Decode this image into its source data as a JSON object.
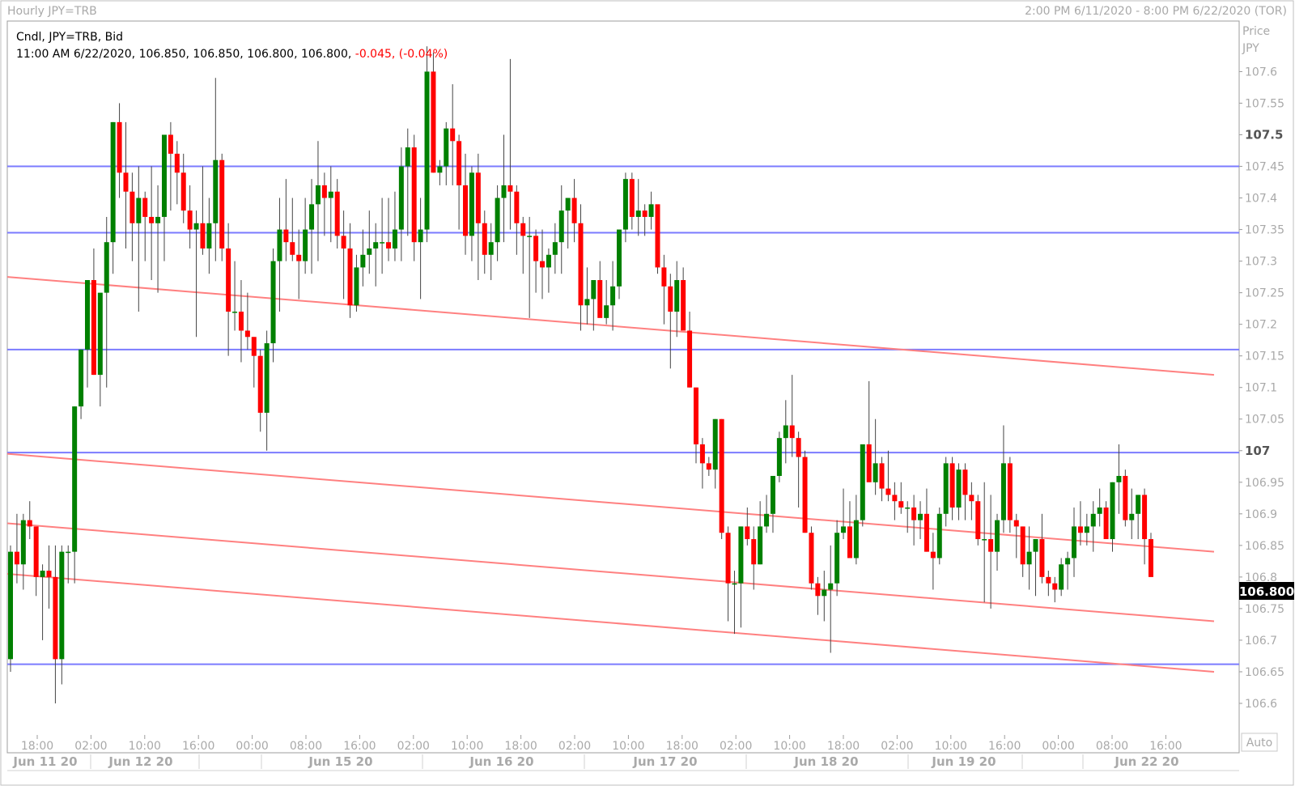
{
  "header": {
    "title": "Hourly JPY=TRB",
    "range": "2:00 PM 6/11/2020 - 8:00 PM 6/22/2020 (TOR)"
  },
  "legend": {
    "line1": "Cndl, JPY=TRB, Bid",
    "line2_prefix": "11:00 AM 6/22/2020, 106.850, 106.850, 106.800, 106.800, ",
    "line2_change": "-0.045, (-0.04%)"
  },
  "axis": {
    "price_label": "Price",
    "currency_label": "JPY",
    "current_price": "106.800",
    "auto_label": "Auto"
  },
  "colors": {
    "up": "#008000",
    "down": "#ff0000",
    "horizontal_levels": "#7b7bff",
    "trend_lines": "#ff8080",
    "price_tag_bg": "#000000"
  },
  "chart_data": {
    "type": "candlestick",
    "ylim": [
      106.55,
      107.68
    ],
    "y_ticks": [
      "106.6",
      "106.65",
      "106.7",
      "106.75",
      "106.8",
      "106.85",
      "106.9",
      "106.95",
      "107",
      "107.05",
      "107.1",
      "107.15",
      "107.2",
      "107.25",
      "107.3",
      "107.35",
      "107.4",
      "107.45",
      "107.5",
      "107.55",
      "107.6"
    ],
    "y_major_ticks": [
      "107",
      "107.5"
    ],
    "x_ticks": [
      "18:00",
      "02:00",
      "10:00",
      "16:00",
      "00:00",
      "08:00",
      "16:00",
      "02:00",
      "10:00",
      "18:00",
      "02:00",
      "10:00",
      "18:00",
      "02:00",
      "10:00",
      "18:00",
      "02:00",
      "10:00",
      "16:00",
      "00:00",
      "08:00",
      "16:00"
    ],
    "date_labels": [
      "Jun 11 20",
      "Jun 12 20",
      "Jun 15 20",
      "Jun 16 20",
      "Jun 17 20",
      "Jun 18 20",
      "Jun 19 20",
      "Jun 22 20"
    ],
    "horizontal_levels": [
      107.45,
      107.345,
      107.16,
      106.997,
      106.662
    ],
    "trend_lines": [
      {
        "start": 107.275,
        "end": 107.12
      },
      {
        "start": 106.995,
        "end": 106.84
      },
      {
        "start": 106.885,
        "end": 106.73
      },
      {
        "start": 106.805,
        "end": 106.65
      }
    ],
    "ohlc": [
      [
        106.67,
        106.85,
        106.65,
        106.84
      ],
      [
        106.84,
        106.9,
        106.79,
        106.82
      ],
      [
        106.82,
        106.9,
        106.78,
        106.89
      ],
      [
        106.89,
        106.92,
        106.86,
        106.88
      ],
      [
        106.88,
        106.87,
        106.77,
        106.8
      ],
      [
        106.8,
        106.82,
        106.7,
        106.81
      ],
      [
        106.81,
        106.85,
        106.75,
        106.8
      ],
      [
        106.8,
        106.85,
        106.6,
        106.67
      ],
      [
        106.67,
        106.85,
        106.63,
        106.84
      ],
      [
        106.84,
        106.85,
        106.79,
        106.84
      ],
      [
        106.84,
        107.07,
        106.79,
        107.07
      ],
      [
        107.07,
        107.16,
        107.05,
        107.16
      ],
      [
        107.16,
        107.27,
        107.1,
        107.27
      ],
      [
        107.27,
        107.32,
        107.12,
        107.12
      ],
      [
        107.12,
        107.2,
        107.07,
        107.25
      ],
      [
        107.25,
        107.37,
        107.1,
        107.33
      ],
      [
        107.33,
        107.52,
        107.28,
        107.52
      ],
      [
        107.52,
        107.55,
        107.4,
        107.44
      ],
      [
        107.44,
        107.52,
        107.32,
        107.41
      ],
      [
        107.41,
        107.44,
        107.3,
        107.36
      ],
      [
        107.36,
        107.45,
        107.22,
        107.4
      ],
      [
        107.4,
        107.41,
        107.3,
        107.37
      ],
      [
        107.37,
        107.45,
        107.27,
        107.36
      ],
      [
        107.36,
        107.42,
        107.25,
        107.37
      ],
      [
        107.37,
        107.5,
        107.3,
        107.5
      ],
      [
        107.5,
        107.52,
        107.38,
        107.47
      ],
      [
        107.47,
        107.49,
        107.39,
        107.44
      ],
      [
        107.44,
        107.47,
        107.36,
        107.38
      ],
      [
        107.38,
        107.42,
        107.32,
        107.35
      ],
      [
        107.35,
        107.38,
        107.18,
        107.36
      ],
      [
        107.36,
        107.45,
        107.31,
        107.32
      ],
      [
        107.32,
        107.4,
        107.28,
        107.36
      ],
      [
        107.36,
        107.59,
        107.3,
        107.46
      ],
      [
        107.46,
        107.47,
        107.3,
        107.32
      ],
      [
        107.32,
        107.36,
        107.15,
        107.22
      ],
      [
        107.22,
        107.3,
        107.19,
        107.22
      ],
      [
        107.22,
        107.27,
        107.14,
        107.19
      ],
      [
        107.19,
        107.25,
        107.16,
        107.18
      ],
      [
        107.18,
        107.18,
        107.1,
        107.15
      ],
      [
        107.15,
        107.16,
        107.03,
        107.06
      ],
      [
        107.06,
        107.19,
        107.0,
        107.17
      ],
      [
        107.17,
        107.32,
        107.14,
        107.3
      ],
      [
        107.3,
        107.4,
        107.22,
        107.35
      ],
      [
        107.35,
        107.43,
        107.3,
        107.33
      ],
      [
        107.33,
        107.4,
        107.3,
        107.31
      ],
      [
        107.31,
        107.35,
        107.24,
        107.3
      ],
      [
        107.3,
        107.4,
        107.28,
        107.35
      ],
      [
        107.35,
        107.43,
        107.28,
        107.39
      ],
      [
        107.39,
        107.49,
        107.3,
        107.42
      ],
      [
        107.42,
        107.44,
        107.34,
        107.4
      ],
      [
        107.4,
        107.45,
        107.33,
        107.41
      ],
      [
        107.41,
        107.43,
        107.32,
        107.34
      ],
      [
        107.34,
        107.38,
        107.24,
        107.32
      ],
      [
        107.32,
        107.36,
        107.21,
        107.23
      ],
      [
        107.23,
        107.31,
        107.22,
        107.29
      ],
      [
        107.29,
        107.35,
        107.26,
        107.31
      ],
      [
        107.31,
        107.38,
        107.28,
        107.32
      ],
      [
        107.32,
        107.36,
        107.26,
        107.33
      ],
      [
        107.33,
        107.4,
        107.28,
        107.33
      ],
      [
        107.33,
        107.4,
        107.3,
        107.32
      ],
      [
        107.32,
        107.41,
        107.3,
        107.35
      ],
      [
        107.35,
        107.48,
        107.3,
        107.45
      ],
      [
        107.45,
        107.51,
        107.34,
        107.48
      ],
      [
        107.48,
        107.5,
        107.3,
        107.33
      ],
      [
        107.33,
        107.4,
        107.24,
        107.35
      ],
      [
        107.35,
        107.64,
        107.33,
        107.6
      ],
      [
        107.6,
        107.63,
        107.44,
        107.44
      ],
      [
        107.44,
        107.46,
        107.42,
        107.45
      ],
      [
        107.45,
        107.52,
        107.42,
        107.51
      ],
      [
        107.51,
        107.58,
        107.42,
        107.49
      ],
      [
        107.49,
        107.5,
        107.35,
        107.42
      ],
      [
        107.42,
        107.47,
        107.31,
        107.34
      ],
      [
        107.34,
        107.45,
        107.3,
        107.44
      ],
      [
        107.44,
        107.47,
        107.27,
        107.36
      ],
      [
        107.36,
        107.38,
        107.28,
        107.31
      ],
      [
        107.31,
        107.36,
        107.27,
        107.33
      ],
      [
        107.33,
        107.42,
        107.3,
        107.4
      ],
      [
        107.4,
        107.5,
        107.33,
        107.42
      ],
      [
        107.42,
        107.62,
        107.35,
        107.41
      ],
      [
        107.41,
        107.42,
        107.31,
        107.36
      ],
      [
        107.36,
        107.37,
        107.28,
        107.34
      ],
      [
        107.34,
        107.37,
        107.21,
        107.34
      ],
      [
        107.34,
        107.35,
        107.25,
        107.3
      ],
      [
        107.3,
        107.35,
        107.24,
        107.29
      ],
      [
        107.29,
        107.32,
        107.25,
        107.31
      ],
      [
        107.31,
        107.36,
        107.28,
        107.33
      ],
      [
        107.33,
        107.42,
        107.28,
        107.38
      ],
      [
        107.38,
        107.4,
        107.32,
        107.4
      ],
      [
        107.4,
        107.43,
        107.33,
        107.36
      ],
      [
        107.36,
        107.39,
        107.19,
        107.23
      ],
      [
        107.23,
        107.29,
        107.2,
        107.24
      ],
      [
        107.24,
        107.26,
        107.19,
        107.27
      ],
      [
        107.27,
        107.3,
        107.22,
        107.21
      ],
      [
        107.21,
        107.27,
        107.2,
        107.23
      ],
      [
        107.23,
        107.3,
        107.19,
        107.26
      ],
      [
        107.26,
        107.35,
        107.24,
        107.35
      ],
      [
        107.35,
        107.44,
        107.33,
        107.43
      ],
      [
        107.43,
        107.44,
        107.35,
        107.37
      ],
      [
        107.37,
        107.43,
        107.34,
        107.38
      ],
      [
        107.38,
        107.39,
        107.34,
        107.37
      ],
      [
        107.37,
        107.41,
        107.35,
        107.39
      ],
      [
        107.39,
        107.38,
        107.28,
        107.29
      ],
      [
        107.29,
        107.31,
        107.2,
        107.26
      ],
      [
        107.26,
        107.28,
        107.13,
        107.22
      ],
      [
        107.22,
        107.3,
        107.18,
        107.27
      ],
      [
        107.27,
        107.29,
        107.2,
        107.19
      ],
      [
        107.19,
        107.22,
        107.1,
        107.1
      ],
      [
        107.1,
        107.1,
        106.98,
        107.01
      ],
      [
        107.01,
        107.02,
        106.94,
        106.98
      ],
      [
        106.98,
        106.99,
        106.96,
        106.97
      ],
      [
        106.97,
        107.05,
        106.94,
        107.05
      ],
      [
        107.05,
        107.05,
        106.86,
        106.87
      ],
      [
        106.87,
        106.88,
        106.73,
        106.79
      ],
      [
        106.79,
        106.81,
        106.71,
        106.79
      ],
      [
        106.79,
        106.88,
        106.72,
        106.88
      ],
      [
        106.88,
        106.91,
        106.85,
        106.86
      ],
      [
        106.86,
        106.88,
        106.78,
        106.82
      ],
      [
        106.82,
        106.92,
        106.82,
        106.88
      ],
      [
        106.88,
        106.93,
        106.87,
        106.9
      ],
      [
        106.9,
        106.96,
        106.87,
        106.96
      ],
      [
        106.96,
        107.03,
        106.95,
        107.02
      ],
      [
        107.02,
        107.08,
        106.98,
        107.04
      ],
      [
        107.04,
        107.12,
        106.99,
        107.02
      ],
      [
        107.02,
        107.03,
        106.91,
        106.99
      ],
      [
        106.99,
        107.0,
        106.87,
        106.87
      ],
      [
        106.87,
        106.88,
        106.78,
        106.79
      ],
      [
        106.79,
        106.8,
        106.74,
        106.77
      ],
      [
        106.77,
        106.81,
        106.73,
        106.78
      ],
      [
        106.78,
        106.85,
        106.68,
        106.79
      ],
      [
        106.79,
        106.89,
        106.77,
        106.87
      ],
      [
        106.87,
        106.94,
        106.86,
        106.88
      ],
      [
        106.88,
        106.92,
        106.83,
        106.83
      ],
      [
        106.83,
        106.93,
        106.82,
        106.89
      ],
      [
        106.89,
        107.0,
        106.88,
        107.01
      ],
      [
        107.01,
        107.11,
        106.96,
        106.95
      ],
      [
        106.95,
        107.05,
        106.93,
        106.98
      ],
      [
        106.98,
        106.99,
        106.92,
        106.94
      ],
      [
        106.94,
        107.0,
        106.92,
        106.93
      ],
      [
        106.93,
        106.95,
        106.89,
        106.92
      ],
      [
        106.92,
        106.95,
        106.9,
        106.91
      ],
      [
        106.91,
        106.92,
        106.87,
        106.91
      ],
      [
        106.91,
        106.93,
        106.85,
        106.89
      ],
      [
        106.89,
        106.92,
        106.86,
        106.9
      ],
      [
        106.9,
        106.94,
        106.84,
        106.84
      ],
      [
        106.84,
        106.87,
        106.78,
        106.83
      ],
      [
        106.83,
        106.91,
        106.82,
        106.9
      ],
      [
        106.9,
        106.99,
        106.88,
        106.98
      ],
      [
        106.98,
        106.99,
        106.89,
        106.91
      ],
      [
        106.91,
        106.98,
        106.89,
        106.97
      ],
      [
        106.97,
        106.98,
        106.89,
        106.93
      ],
      [
        106.93,
        106.95,
        106.89,
        106.92
      ],
      [
        106.92,
        106.93,
        106.85,
        106.86
      ],
      [
        106.86,
        106.95,
        106.76,
        106.86
      ],
      [
        106.86,
        106.93,
        106.75,
        106.84
      ],
      [
        106.84,
        106.9,
        106.81,
        106.89
      ],
      [
        106.89,
        107.04,
        106.87,
        106.98
      ],
      [
        106.98,
        106.99,
        106.87,
        106.89
      ],
      [
        106.89,
        106.9,
        106.83,
        106.88
      ],
      [
        106.88,
        106.88,
        106.8,
        106.82
      ],
      [
        106.82,
        106.88,
        106.78,
        106.84
      ],
      [
        106.84,
        106.86,
        106.77,
        106.86
      ],
      [
        106.86,
        106.9,
        106.79,
        106.8
      ],
      [
        106.8,
        106.81,
        106.77,
        106.79
      ],
      [
        106.79,
        106.8,
        106.76,
        106.78
      ],
      [
        106.78,
        106.83,
        106.77,
        106.82
      ],
      [
        106.82,
        106.84,
        106.78,
        106.83
      ],
      [
        106.83,
        106.91,
        106.8,
        106.88
      ],
      [
        106.88,
        106.92,
        106.85,
        106.87
      ],
      [
        106.87,
        106.9,
        106.85,
        106.88
      ],
      [
        106.88,
        106.92,
        106.84,
        106.9
      ],
      [
        106.9,
        106.94,
        106.88,
        106.91
      ],
      [
        106.91,
        106.92,
        106.87,
        106.86
      ],
      [
        106.86,
        106.95,
        106.84,
        106.95
      ],
      [
        106.95,
        107.01,
        106.9,
        106.96
      ],
      [
        106.96,
        106.97,
        106.88,
        106.89
      ],
      [
        106.89,
        106.94,
        106.86,
        106.9
      ],
      [
        106.9,
        106.93,
        106.86,
        106.93
      ],
      [
        106.93,
        106.94,
        106.82,
        106.86
      ],
      [
        106.86,
        106.87,
        106.8,
        106.8
      ]
    ]
  }
}
